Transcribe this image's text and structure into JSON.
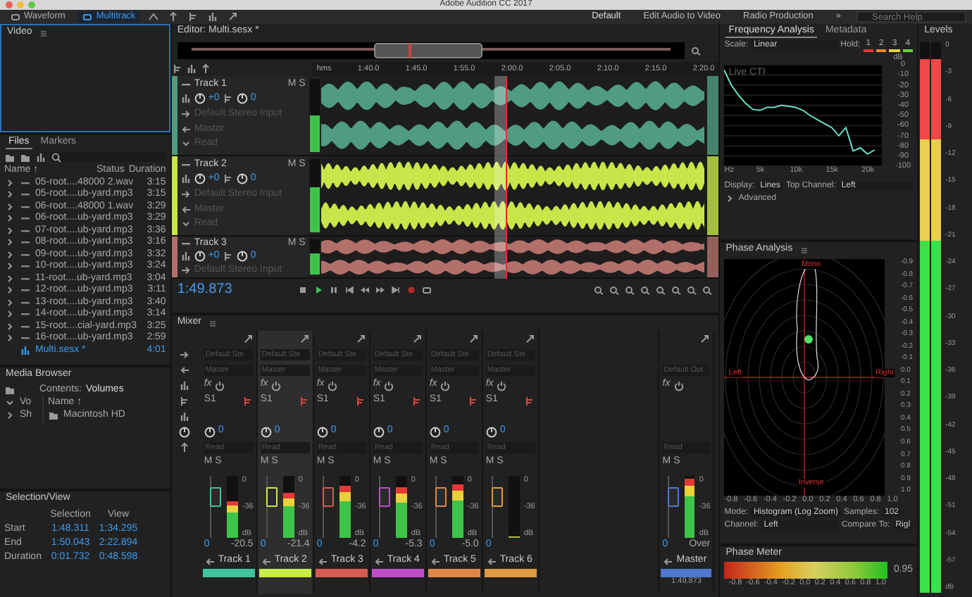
{
  "titlebar": {
    "title": "Adobe Audition CC 2017",
    "view_tabs": [
      {
        "label": "Waveform",
        "selected": false
      },
      {
        "label": "Multitrack",
        "selected": true
      }
    ],
    "workspaces": [
      {
        "label": "Default",
        "selected": true
      },
      {
        "label": "Edit Audio to Video",
        "selected": false
      },
      {
        "label": "Radio Production",
        "selected": false
      }
    ],
    "more": "»",
    "search": {
      "placeholder": "Search Help"
    }
  },
  "video_panel": {
    "title": "Video"
  },
  "files_panel": {
    "tabs": [
      {
        "label": "Files",
        "selected": true
      },
      {
        "label": "Markers",
        "selected": false
      }
    ],
    "columns": [
      "Name ↑",
      "Status",
      "Duration"
    ],
    "rows": [
      {
        "kind": "audio",
        "name": "05-root....48000 2.wav",
        "duration": "3:15"
      },
      {
        "kind": "audio",
        "name": "05-root....ub-yard.mp3",
        "duration": "3:15"
      },
      {
        "kind": "audio",
        "name": "06-root....48000 1.wav",
        "duration": "3:29"
      },
      {
        "kind": "audio",
        "name": "06-root....ub-yard.mp3",
        "duration": "3:29"
      },
      {
        "kind": "audio",
        "name": "07-root....ub-yard.mp3",
        "duration": "3:36"
      },
      {
        "kind": "audio",
        "name": "08-root....ub-yard.mp3",
        "duration": "3:16"
      },
      {
        "kind": "audio",
        "name": "09-root....ub-yard.mp3",
        "duration": "3:32"
      },
      {
        "kind": "audio",
        "name": "10-root....ub-yard.mp3",
        "duration": "3:24"
      },
      {
        "kind": "audio",
        "name": "11-root....ub-yard.mp3",
        "duration": "3:04"
      },
      {
        "kind": "audio",
        "name": "12-root....ub-yard.mp3",
        "duration": "3:11"
      },
      {
        "kind": "audio",
        "name": "13-root....ub-yard.mp3",
        "duration": "3:40"
      },
      {
        "kind": "audio",
        "name": "14-root....ub-yard.mp3",
        "duration": "3:14"
      },
      {
        "kind": "audio",
        "name": "15-root....cial-yard.mp3",
        "duration": "3:25"
      },
      {
        "kind": "audio",
        "name": "16-root....ub-yard.mp3",
        "duration": "2:59"
      },
      {
        "kind": "session",
        "name": "Multi.sesx *",
        "duration": "4:01"
      }
    ]
  },
  "media_browser": {
    "title": "Media Browser",
    "contents_label": "Contents:",
    "contents_value": "Volumes",
    "tree": [
      {
        "name": "Vo",
        "expanded": true
      },
      {
        "name": "Sh",
        "expanded": false
      }
    ],
    "column": "Name ↑",
    "items": [
      "Macintosh HD"
    ]
  },
  "selection_view": {
    "title": "Selection/View",
    "columns": [
      "Selection",
      "View"
    ],
    "rows": [
      {
        "label": "Start",
        "selection": "1:48.311",
        "view": "1:34.295"
      },
      {
        "label": "End",
        "selection": "1:50.043",
        "view": "2:22.894"
      },
      {
        "label": "Duration",
        "selection": "0:01.732",
        "view": "0:48.598"
      }
    ]
  },
  "editor": {
    "title": "Editor: Multi.sesx *",
    "ruler": [
      "hms",
      "1:40.0",
      "1:45.0",
      "1:55.0",
      "2:00.0",
      "2:05.0",
      "2:10.0",
      "2:15.0",
      "2:20.0"
    ],
    "time": "1:49.873",
    "tracks": [
      {
        "name": "Track 1",
        "color": "#4f9c80",
        "buttons": [
          "M",
          "S"
        ],
        "volume": "+0",
        "pan": "0",
        "input": "Default Stereo Input",
        "output": "Master",
        "automation": "Read",
        "level": 0.5
      },
      {
        "name": "Track 2",
        "color": "#c6e64a",
        "buttons": [
          "M",
          "S"
        ],
        "volume": "+0",
        "pan": "0",
        "input": "Default Stereo Input",
        "output": "Master",
        "automation": "Read",
        "level": 0.62
      },
      {
        "name": "Track 3",
        "color": "#b2706a",
        "buttons": [
          "M",
          "S"
        ],
        "volume": "+0",
        "pan": "0",
        "input": "Default Stereo Input",
        "level": 0.6
      }
    ]
  },
  "mixer": {
    "title": "Mixer",
    "channels": [
      {
        "kind": "track",
        "name": "Track 1",
        "color": "#3fc4a0",
        "selected": false,
        "input": "Default Ste",
        "output": "Master",
        "fx": "fx",
        "send": "S1",
        "pan": "0",
        "automation": "Read",
        "buttons": [
          "M",
          "S"
        ],
        "volume": "0",
        "peak": "-20.5",
        "level": 0.58,
        "meter_scale": [
          "0",
          "-36",
          "dB"
        ]
      },
      {
        "kind": "track",
        "name": "Track 2",
        "color": "#c8ec48",
        "selected": true,
        "input": "Default Ste",
        "output": "Master",
        "fx": "fx",
        "send": "S1",
        "pan": "0",
        "automation": "Read",
        "buttons": [
          "M",
          "S"
        ],
        "volume": "0",
        "peak": "-21.4",
        "level": 0.73,
        "meter_scale": [
          "0",
          "-36",
          "dB"
        ]
      },
      {
        "kind": "track",
        "name": "Track 3",
        "color": "#d85a50",
        "selected": false,
        "input": "Default Ste",
        "output": "Master",
        "fx": "fx",
        "send": "S1",
        "pan": "0",
        "automation": "Read",
        "buttons": [
          "M",
          "S"
        ],
        "volume": "0",
        "peak": "-4.2",
        "level": 0.85,
        "meter_scale": [
          "0",
          "-36",
          "dB"
        ]
      },
      {
        "kind": "track",
        "name": "Track 4",
        "color": "#c04cc8",
        "selected": false,
        "input": "Default Ste",
        "output": "Master",
        "fx": "fx",
        "send": "S1",
        "pan": "0",
        "automation": "Read",
        "buttons": [
          "M",
          "S"
        ],
        "volume": "0",
        "peak": "-5.3",
        "level": 0.82,
        "meter_scale": [
          "0",
          "-36",
          "dB"
        ]
      },
      {
        "kind": "track",
        "name": "Track 5",
        "color": "#e0884a",
        "selected": false,
        "input": "Default Ste",
        "output": "Master",
        "fx": "fx",
        "send": "S1",
        "pan": "0",
        "automation": "Read",
        "buttons": [
          "M",
          "S"
        ],
        "volume": "0",
        "peak": "-5.0",
        "level": 0.86,
        "meter_scale": [
          "0",
          "-36",
          "dB"
        ]
      },
      {
        "kind": "track",
        "name": "Track 6",
        "color": "#e09a40",
        "selected": false,
        "input": "Default Ste",
        "output": "Master",
        "fx": "fx",
        "send": "S1",
        "pan": "0",
        "automation": "Read",
        "buttons": [
          "M",
          "S"
        ],
        "volume": "0",
        "level": 0.02,
        "meter_scale": [
          "0",
          "-36",
          "dB"
        ]
      },
      {
        "kind": "master",
        "name": "Master",
        "color": "#4e78d0",
        "selected": false,
        "output": "Default Out",
        "fx": "fx",
        "automation": "Read",
        "buttons": [
          "M",
          "S"
        ],
        "volume": "0",
        "peak": "Over",
        "level": 0.96,
        "meter_scale": [
          "0",
          "-36",
          "dB"
        ],
        "time": "1:49.873"
      }
    ]
  },
  "frequency_analysis": {
    "tabs": [
      {
        "label": "Frequency Analysis",
        "selected": true
      },
      {
        "label": "Metadata",
        "selected": false
      }
    ],
    "scale_label": "Scale:",
    "scale": "Linear",
    "hold_label": "Hold:",
    "hold": [
      {
        "label": "1",
        "color": "#e53935"
      },
      {
        "label": "2",
        "color": "#ef8a25"
      },
      {
        "label": "3",
        "color": "#e8d13a"
      },
      {
        "label": "4",
        "color": "#6ad23a"
      }
    ],
    "live_label": "Live CTI",
    "chart_data": {
      "type": "line",
      "xlabel": "Hz",
      "ylabel": "dB",
      "x": [
        0,
        1000,
        2000,
        3000,
        4000,
        5000,
        6000,
        7000,
        8000,
        9000,
        10000,
        11000,
        12000,
        13000,
        14000,
        15000,
        16000,
        17000,
        18000,
        19000,
        20000,
        21000
      ],
      "series": [
        {
          "color": "#6ee0c8",
          "values": [
            -5,
            -20,
            -30,
            -38,
            -44,
            -45,
            -42,
            -42,
            -40,
            -41,
            -42,
            -45,
            -50,
            -54,
            -58,
            -62,
            -70,
            -62,
            -85,
            -82,
            -88,
            -84
          ]
        }
      ],
      "grid": true,
      "xlim": [
        0,
        22000
      ],
      "ylim": [
        -100,
        0
      ],
      "xticks": [
        {
          "value": 5000,
          "label": "5k"
        },
        {
          "value": 10000,
          "label": "10k"
        },
        {
          "value": 15000,
          "label": "15k"
        },
        {
          "value": 20000,
          "label": "20k"
        }
      ],
      "yticks": [
        {
          "value": 0,
          "label": "0"
        },
        {
          "value": -10,
          "label": "-10"
        },
        {
          "value": -20,
          "label": "-20"
        },
        {
          "value": -30,
          "label": "-30"
        },
        {
          "value": -40,
          "label": "-40"
        },
        {
          "value": -50,
          "label": "-50"
        },
        {
          "value": -60,
          "label": "-60"
        },
        {
          "value": -70,
          "label": "-70"
        },
        {
          "value": -80,
          "label": "-80"
        },
        {
          "value": -90,
          "label": "-90"
        },
        {
          "value": -100,
          "label": "-100"
        }
      ]
    },
    "display_label": "Display:",
    "display": "Lines",
    "top_channel_label": "Top Channel:",
    "top_channel": "Left",
    "advanced": {
      "label": "Advanced",
      "expanded": false
    }
  },
  "phase_analysis": {
    "title": "Phase Analysis",
    "labels": {
      "top": "Mono",
      "left": "Left",
      "right": "Right",
      "bottom": "Inverse"
    },
    "y_axis": [
      "-0.9",
      "-0.8",
      "-0.7",
      "-0.6",
      "-0.5",
      "-0.4",
      "-0.3",
      "-0.2",
      "-0.1",
      "0.0",
      "0.1",
      "0.2",
      "0.3",
      "0.4",
      "0.5",
      "0.6",
      "0.7",
      "0.8",
      "0.9",
      "1.0"
    ],
    "x_axis": [
      "-0.8",
      "-0.6",
      "-0.4",
      "-0.2",
      "0.0",
      "0.2",
      "0.4",
      "0.6",
      "0.8",
      "1.0"
    ],
    "mode_label": "Mode:",
    "mode": "Histogram (Log Zoom)",
    "samples_label": "Samples:",
    "samples": "102",
    "channel_label": "Channel:",
    "channel": "Left",
    "compare_label": "Compare To:",
    "compare": "Rigl"
  },
  "phase_meter": {
    "title": "Phase Meter",
    "reading": "0.95",
    "ticks": [
      "-0.8",
      "-0.6",
      "-0.4",
      "-0.2",
      "0.0",
      "0.2",
      "0.4",
      "0.6",
      "0.8",
      "1.0"
    ]
  },
  "levels": {
    "title": "Levels",
    "level": 0.97,
    "scale": [
      "0",
      "-3",
      "-6",
      "-9",
      "-12",
      "-15",
      "-18",
      "-21",
      "-24",
      "-27",
      "-30",
      "-33",
      "-36",
      "-39",
      "-42",
      "-45",
      "-48",
      "-51",
      "-54",
      "-57",
      "dB"
    ]
  }
}
